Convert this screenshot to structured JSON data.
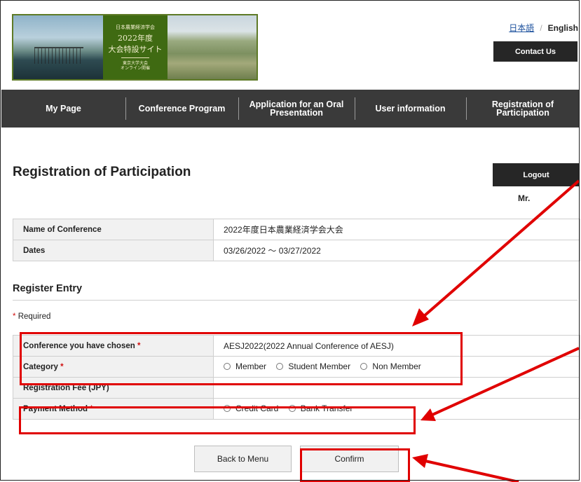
{
  "header": {
    "banner": {
      "line1": "日本農業経済学会",
      "line2": "2022年度",
      "line3": "大会特設サイト",
      "line4": "東京大学大会",
      "line5": "オンライン開催"
    },
    "lang_ja": "日本語",
    "lang_sep": "/",
    "lang_en": "English",
    "contact_label": "Contact Us"
  },
  "nav": {
    "items": [
      {
        "label": "My Page"
      },
      {
        "label": "Conference Program"
      },
      {
        "label": "Application for an Oral\nPresentation"
      },
      {
        "label": "User information"
      },
      {
        "label": "Registration of\nParticipation"
      }
    ]
  },
  "page": {
    "title": "Registration of Participation",
    "logout_label": "Logout",
    "user_salutation": "Mr."
  },
  "info_table": {
    "rows": [
      {
        "label": "Name of Conference",
        "value": "2022年度日本農業経済学会大会"
      },
      {
        "label": "Dates",
        "value": "03/26/2022 ～ 03/27/2022"
      }
    ]
  },
  "entry": {
    "section_title": "Register Entry",
    "required_mark": "*",
    "required_text": "Required",
    "conference_label": "Conference you have chosen",
    "conference_value": "AESJ2022(2022 Annual Conference of AESJ)",
    "category_label": "Category",
    "category_options": [
      "Member",
      "Student Member",
      "Non Member"
    ],
    "fee_label": "Registration Fee (JPY)",
    "fee_value": "",
    "payment_label": "Payment Method",
    "payment_options": [
      "Credit Card",
      "Bank Transfer"
    ]
  },
  "buttons": {
    "back_label": "Back to Menu",
    "confirm_label": "Confirm"
  },
  "colors": {
    "nav_bg": "#3a3a3a",
    "dark_button": "#262626",
    "required": "#d01010",
    "annotation": "#e00000",
    "banner_green": "#3f6a12"
  }
}
